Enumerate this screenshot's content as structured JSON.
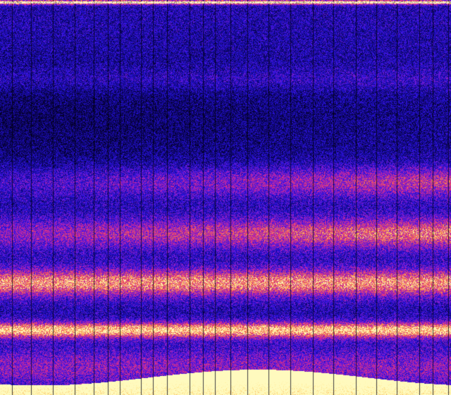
{
  "image": {
    "kind": "spectrogram",
    "description_colors": {
      "background_dark": "#06003a",
      "low": "#1a10b8",
      "mid_low": "#3a18e0",
      "mid": "#9a20c8",
      "mid_high": "#e0307a",
      "high": "#f08a4a",
      "peak": "#fff0a0"
    },
    "bands": [
      {
        "center_frac": 0.0,
        "strength": 0.9
      },
      {
        "center_frac": 0.2,
        "strength": 0.35
      },
      {
        "center_frac": 0.46,
        "strength": 0.55
      },
      {
        "center_frac": 0.59,
        "strength": 0.7
      },
      {
        "center_frac": 0.71,
        "strength": 0.95
      },
      {
        "center_frac": 0.83,
        "strength": 1.0
      },
      {
        "center_frac": 0.97,
        "strength": 1.0
      }
    ],
    "vertical_gridlines": true
  }
}
